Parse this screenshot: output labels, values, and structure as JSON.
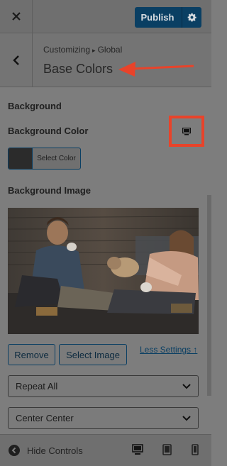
{
  "header": {
    "close_icon": "close-icon",
    "publish_label": "Publish",
    "gear_icon": "gear-icon"
  },
  "section": {
    "breadcrumb_parent": "Customizing",
    "breadcrumb_separator": "▸",
    "breadcrumb_current": "Global",
    "title": "Base Colors",
    "back_icon": "chevron-left-icon",
    "annotation_color": "#e8432a"
  },
  "background": {
    "heading": "Background",
    "color_label": "Background Color",
    "device_icon": "desktop-icon",
    "swatch_color": "#2b2b2b",
    "select_color_label": "Select Color",
    "image_label": "Background Image",
    "remove_label": "Remove",
    "select_image_label": "Select Image",
    "less_settings_label": "Less Settings ↑",
    "repeat_value": "Repeat All",
    "position_value": "Center Center"
  },
  "footer": {
    "hide_controls_label": "Hide Controls",
    "devices": [
      "desktop-icon",
      "tablet-icon",
      "mobile-icon"
    ]
  },
  "colors": {
    "accent": "#0a3f63",
    "highlight": "#e8432a"
  }
}
